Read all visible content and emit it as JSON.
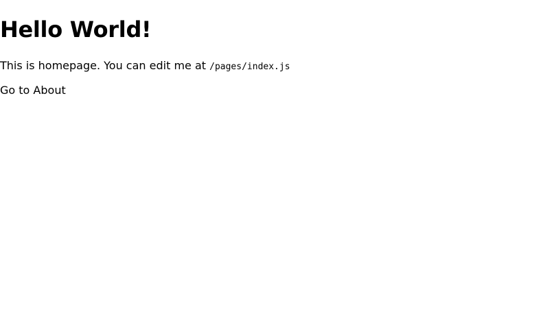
{
  "main": {
    "heading": "Hello World!",
    "intro_text": "This is homepage. You can edit me at ",
    "file_path": "/pages/index.js",
    "about_link": "Go to About"
  }
}
